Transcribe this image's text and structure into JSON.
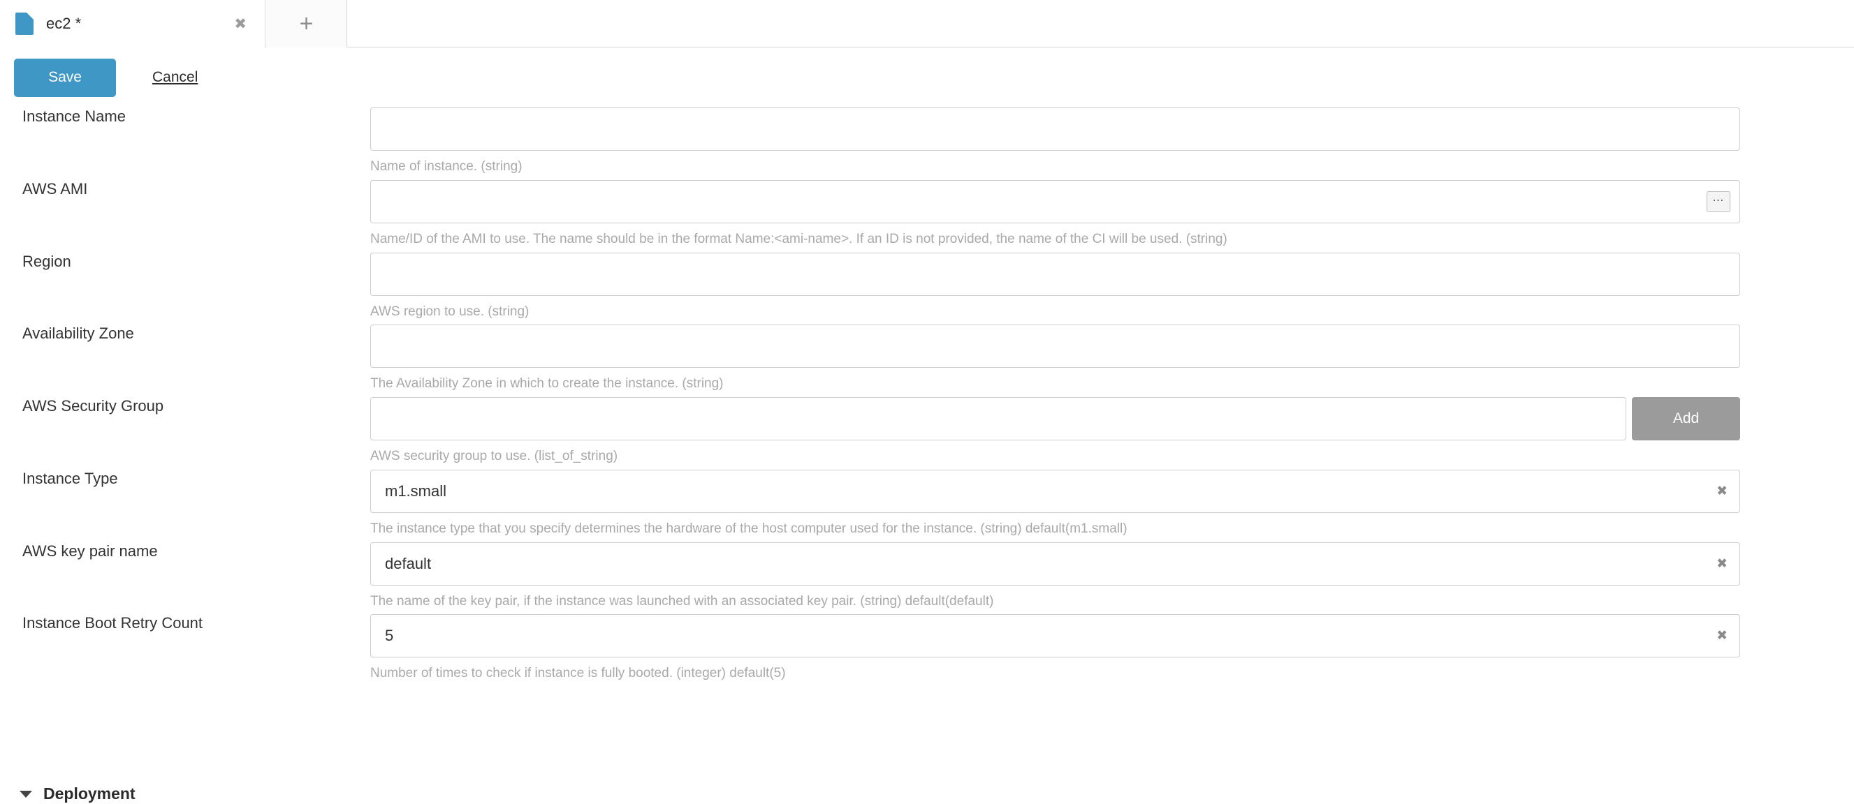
{
  "tab": {
    "title": "ec2 *",
    "file_icon": "file-icon",
    "close_icon": "✖",
    "new_tab_label": "+"
  },
  "toolbar": {
    "save_label": "Save",
    "cancel_label": "Cancel",
    "save_color": "#3e97c4"
  },
  "form": {
    "fields": [
      {
        "label": "Instance Name",
        "value": "",
        "help": "Name of instance. (string)",
        "control": "text",
        "name": "instance-name"
      },
      {
        "label": "AWS AMI",
        "value": "",
        "help": "Name/ID of the AMI to use. The name should be in the format Name:<ami-name>. If an ID is not provided, the name of the CI will be used. (string)",
        "control": "text-browse",
        "browse_label": "⋯",
        "name": "aws-ami"
      },
      {
        "label": "Region",
        "value": "",
        "help": "AWS region to use. (string)",
        "control": "text",
        "name": "region"
      },
      {
        "label": "Availability Zone",
        "value": "",
        "help": "The Availability Zone in which to create the instance. (string)",
        "control": "text",
        "name": "availability-zone"
      },
      {
        "label": "AWS Security Group",
        "value": "",
        "help": "AWS security group to use. (list_of_string)",
        "control": "text-add",
        "add_label": "Add",
        "name": "aws-security-group"
      },
      {
        "label": "Instance Type",
        "value": "m1.small",
        "help": "The instance type that you specify determines the hardware of the host computer used for the instance. (string) default(m1.small)",
        "control": "text-clear",
        "clear_icon": "✖",
        "name": "instance-type"
      },
      {
        "label": "AWS key pair name",
        "value": "default",
        "help": "The name of the key pair, if the instance was launched with an associated key pair. (string) default(default)",
        "control": "text-clear",
        "clear_icon": "✖",
        "name": "aws-key-pair-name"
      },
      {
        "label": "Instance Boot Retry Count",
        "value": "5",
        "help": "Number of times to check if instance is fully booted. (integer) default(5)",
        "control": "text-clear",
        "clear_icon": "✖",
        "name": "instance-boot-retry-count"
      }
    ],
    "section": {
      "label": "Deployment",
      "expanded": true
    }
  }
}
